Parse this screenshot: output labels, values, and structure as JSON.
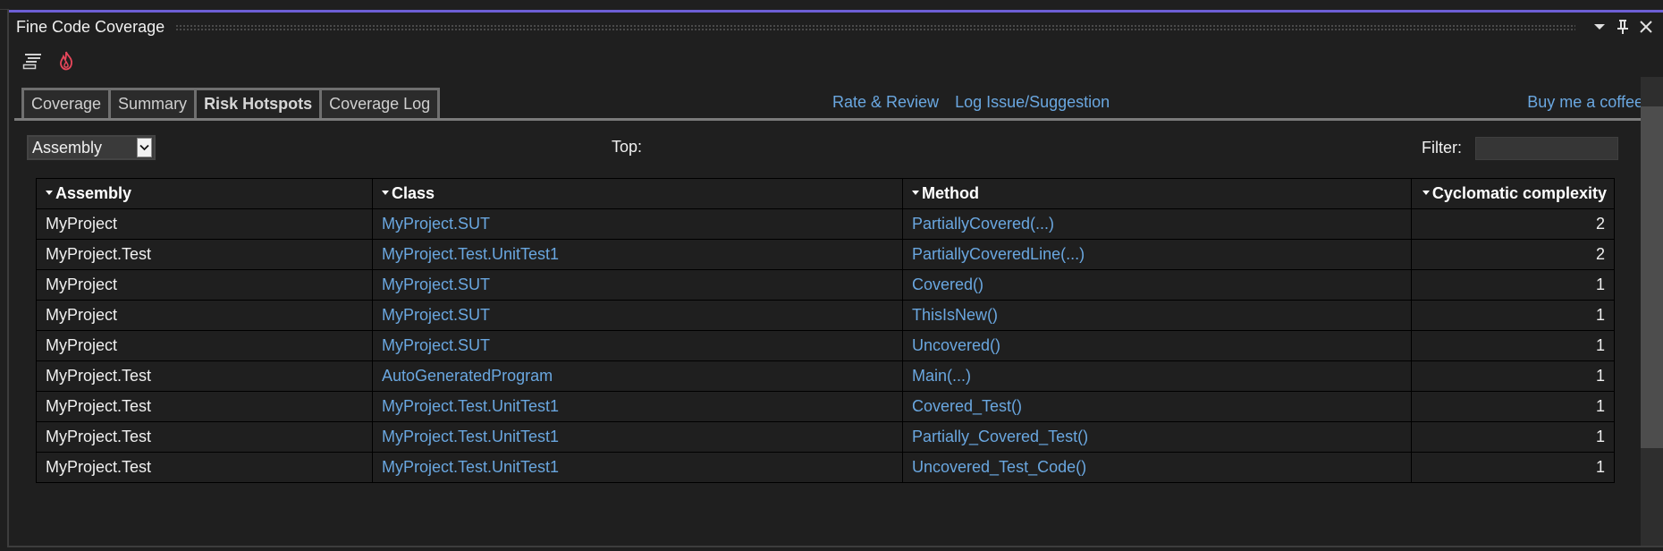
{
  "window": {
    "title": "Fine Code Coverage",
    "buttons": [
      {
        "name": "dropdown",
        "icon": "triangle-down-icon",
        "glyph": "▼"
      },
      {
        "name": "pin",
        "icon": "pin-icon",
        "glyph": "📌"
      },
      {
        "name": "close",
        "icon": "close-icon",
        "glyph": "✕"
      }
    ]
  },
  "toolbar": {
    "items": [
      {
        "name": "options",
        "icon": "options-list-icon"
      },
      {
        "name": "hotspots",
        "icon": "flame-icon",
        "color": "#e8475b"
      }
    ]
  },
  "tabs": [
    {
      "label": "Coverage",
      "active": false
    },
    {
      "label": "Summary",
      "active": false
    },
    {
      "label": "Risk Hotspots",
      "active": true
    },
    {
      "label": "Coverage Log",
      "active": false
    }
  ],
  "links": {
    "rate_review": "Rate & Review",
    "log_issue": "Log Issue/Suggestion",
    "buy_coffee": "Buy me a coffee"
  },
  "controls": {
    "group_by": {
      "selected": "Assembly"
    },
    "top_label": "Top:",
    "filter_label": "Filter:",
    "filter_value": ""
  },
  "table": {
    "columns": [
      {
        "label": "Assembly"
      },
      {
        "label": "Class"
      },
      {
        "label": "Method"
      },
      {
        "label": "Cyclomatic complexity"
      }
    ],
    "rows": [
      {
        "assembly": "MyProject",
        "class": "MyProject.SUT",
        "method": "PartiallyCovered(...)",
        "complexity": "2"
      },
      {
        "assembly": "MyProject.Test",
        "class": "MyProject.Test.UnitTest1",
        "method": "PartiallyCoveredLine(...)",
        "complexity": "2"
      },
      {
        "assembly": "MyProject",
        "class": "MyProject.SUT",
        "method": "Covered()",
        "complexity": "1"
      },
      {
        "assembly": "MyProject",
        "class": "MyProject.SUT",
        "method": "ThisIsNew()",
        "complexity": "1"
      },
      {
        "assembly": "MyProject",
        "class": "MyProject.SUT",
        "method": "Uncovered()",
        "complexity": "1"
      },
      {
        "assembly": "MyProject.Test",
        "class": "AutoGeneratedProgram",
        "method": "Main(...)",
        "complexity": "1"
      },
      {
        "assembly": "MyProject.Test",
        "class": "MyProject.Test.UnitTest1",
        "method": "Covered_Test()",
        "complexity": "1"
      },
      {
        "assembly": "MyProject.Test",
        "class": "MyProject.Test.UnitTest1",
        "method": "Partially_Covered_Test()",
        "complexity": "1"
      },
      {
        "assembly": "MyProject.Test",
        "class": "MyProject.Test.UnitTest1",
        "method": "Uncovered_Test_Code()",
        "complexity": "1"
      }
    ]
  },
  "colors": {
    "accent": "#6d5fd5",
    "link": "#6aa7e0",
    "background": "#1f1f1f"
  }
}
